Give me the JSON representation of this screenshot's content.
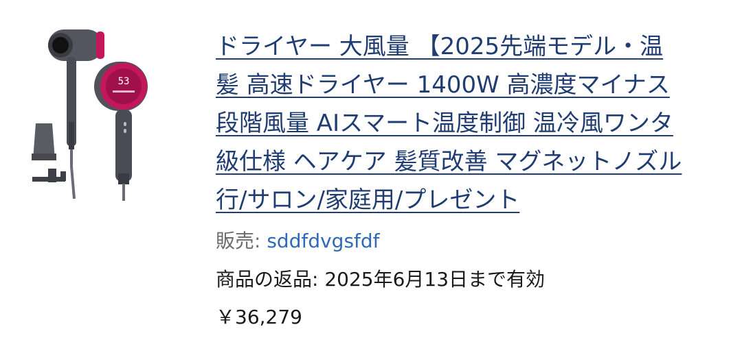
{
  "product": {
    "image_alt": "hair-dryer-product-image",
    "display_reading": "53",
    "title_lines": [
      "ドライヤー 大風量 【2025先端モデル・温",
      "髪 高速ドライヤー 1400W 高濃度マイナス",
      "段階風量 AIスマート温度制御 温冷風ワンタ",
      "級仕様 ヘアケア 髪質改善 マグネットノズル",
      "行/サロン/家庭用/プレゼント"
    ],
    "seller_prefix": "販売: ",
    "seller_name": "sddfdvgsfdf",
    "return_policy": "商品の返品: 2025年6月13日まで有効",
    "price": "￥36,279"
  },
  "colors": {
    "title_link": "#1f3d73",
    "seller_link": "#2e6ab8",
    "accent_magenta": "#c2185b",
    "dryer_body": "#4a4c55"
  }
}
